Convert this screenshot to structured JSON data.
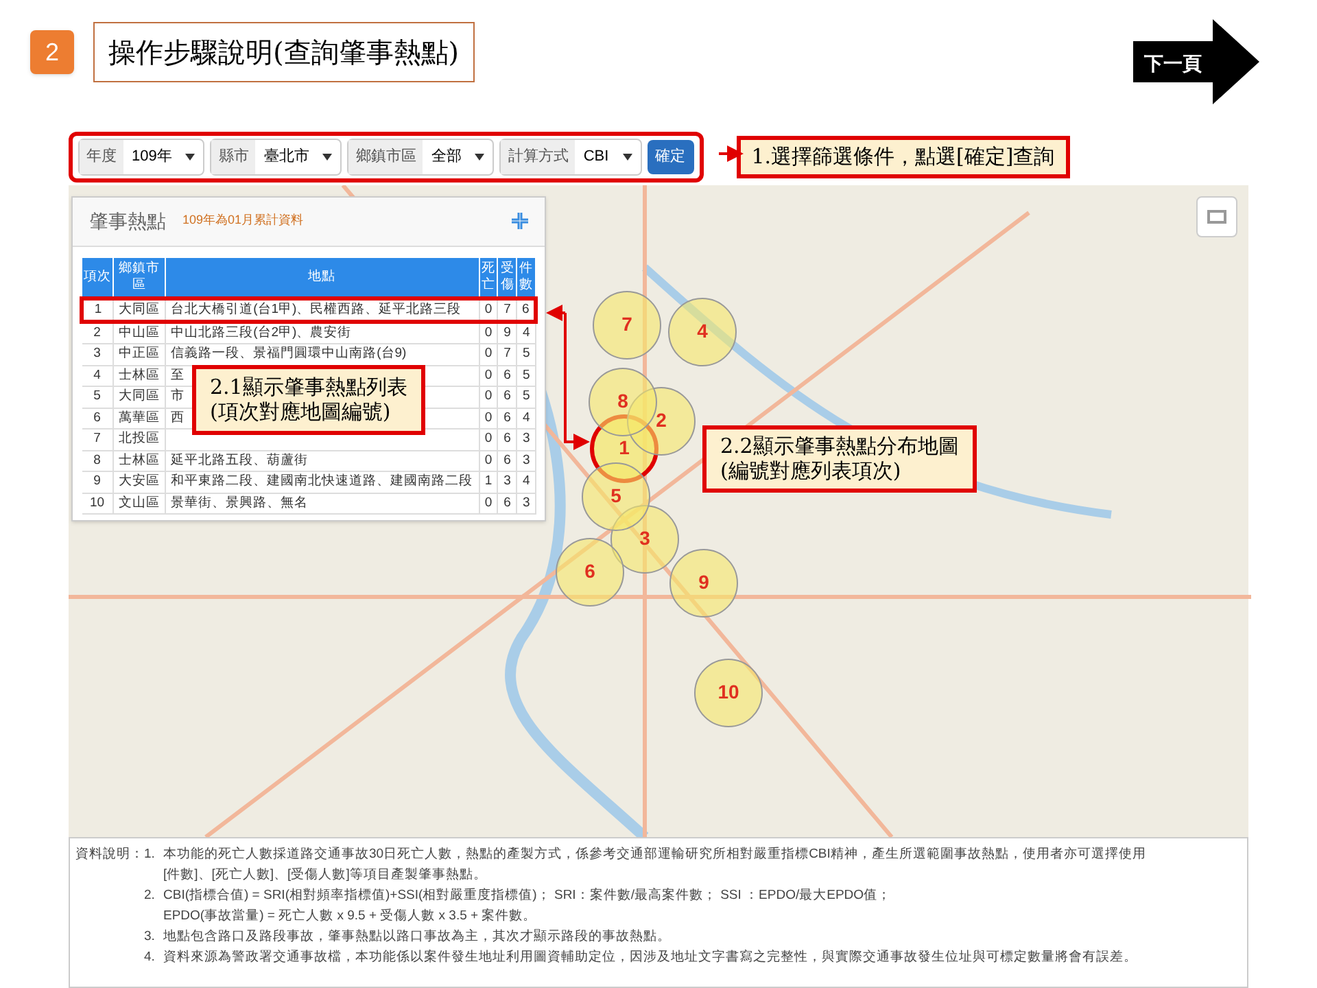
{
  "step_badge": "2",
  "title": "操作步驟說明(查詢肇事熱點)",
  "next_page": "下一頁",
  "filters": [
    {
      "label": "年度",
      "value": "109年"
    },
    {
      "label": "縣市",
      "value": "臺北市"
    },
    {
      "label": "鄉鎮市區",
      "value": "全部"
    },
    {
      "label": "計算方式",
      "value": "CBI"
    }
  ],
  "confirm_button": "確定",
  "callouts": [
    "1.選擇篩選條件，點選[確定]查詢",
    "2.1顯示肇事熱點列表\n(項次對應地圖編號)",
    "2.2顯示肇事熱點分布地圖\n(編號對應列表項次)"
  ],
  "panel": {
    "title": "肇事熱點",
    "subtitle": "109年為01月累計資料"
  },
  "table": {
    "columns": [
      "項次",
      "鄉鎮市區",
      "地點",
      "死亡",
      "受傷",
      "件數"
    ],
    "rows": [
      {
        "cells": [
          "1",
          "大同區",
          "台北大橋引道(台1甲)、民權西路、延平北路三段",
          "0",
          "7",
          "6"
        ],
        "highlighted": true
      },
      {
        "cells": [
          "2",
          "中山區",
          "中山北路三段(台2甲)、農安街",
          "0",
          "9",
          "4"
        ],
        "highlighted": false
      },
      {
        "cells": [
          "3",
          "中正區",
          "信義路一段、景福門圓環中山南路(台9)",
          "0",
          "7",
          "5"
        ],
        "highlighted": false
      },
      {
        "cells": [
          "4",
          "士林區",
          "至",
          "0",
          "6",
          "5"
        ],
        "highlighted": false
      },
      {
        "cells": [
          "5",
          "大同區",
          "市",
          "0",
          "6",
          "5"
        ],
        "highlighted": false
      },
      {
        "cells": [
          "6",
          "萬華區",
          "西",
          "0",
          "6",
          "4"
        ],
        "highlighted": false
      },
      {
        "cells": [
          "7",
          "北投區",
          "",
          "0",
          "6",
          "3"
        ],
        "highlighted": false
      },
      {
        "cells": [
          "8",
          "士林區",
          "延平北路五段、葫蘆街",
          "0",
          "6",
          "3"
        ],
        "highlighted": false
      },
      {
        "cells": [
          "9",
          "大安區",
          "和平東路二段、建國南北快速道路、建國南路二段",
          "1",
          "3",
          "4"
        ],
        "highlighted": false
      },
      {
        "cells": [
          "10",
          "文山區",
          "景華街、景興路、無名",
          "0",
          "6",
          "3"
        ],
        "highlighted": false
      }
    ]
  },
  "map": {
    "hotspots": [
      {
        "label": "1",
        "highlighted": true
      },
      {
        "label": "2",
        "highlighted": false
      },
      {
        "label": "3",
        "highlighted": false
      },
      {
        "label": "4",
        "highlighted": false
      },
      {
        "label": "5",
        "highlighted": false
      },
      {
        "label": "6",
        "highlighted": false
      },
      {
        "label": "7",
        "highlighted": false
      },
      {
        "label": "8",
        "highlighted": false
      },
      {
        "label": "9",
        "highlighted": false
      },
      {
        "label": "10",
        "highlighted": false
      }
    ]
  },
  "notes": {
    "heading": "資料說明：",
    "items": [
      {
        "marker": "1.",
        "lines": [
          "本功能的死亡人數採道路交通事故30日死亡人數，熱點的產製方式，係參考交通部運輸研究所相對嚴重指標CBI精神，產生所選範圍事故熱點，使用者亦可選擇使用",
          "[件數]、[死亡人數]、[受傷人數]等項目產製肇事熱點。"
        ]
      },
      {
        "marker": "2.",
        "lines": [
          "CBI(指標合值) = SRI(相對頻率指標值)+SSI(相對嚴重度指標值)；  SRI：案件數/最高案件數；  SSI ：EPDO/最大EPDO值；",
          "EPDO(事故當量) = 死亡人數 x 9.5 + 受傷人數 x 3.5 + 案件數。"
        ]
      },
      {
        "marker": "3.",
        "lines": [
          "地點包含路口及路段事故，肇事熱點以路口事故為主，其次才顯示路段的事故熱點。"
        ]
      },
      {
        "marker": "4.",
        "lines": [
          "資料來源為警政署交通事故檔，本功能係以案件發生地址利用圖資輔助定位，因涉及地址文字書寫之完整性，與實際交通事故發生位址與可標定數量將會有誤差。"
        ]
      }
    ]
  }
}
